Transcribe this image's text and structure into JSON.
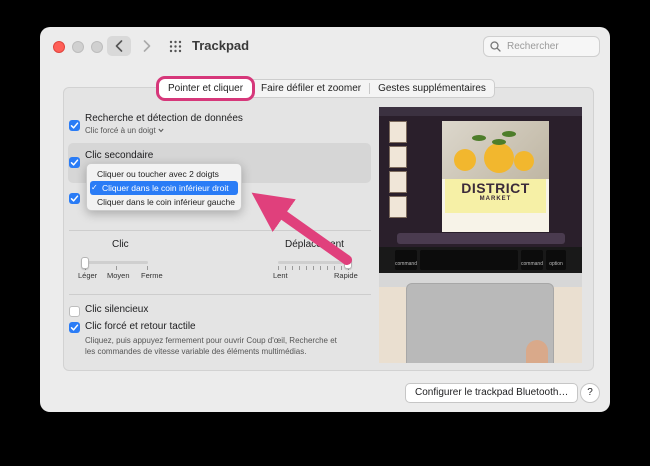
{
  "window": {
    "title": "Trackpad",
    "search_placeholder": "Rechercher"
  },
  "tabs": [
    {
      "label": "Pointer et cliquer",
      "active": true
    },
    {
      "label": "Faire défiler et zoomer",
      "active": false
    },
    {
      "label": "Gestes supplémentaires",
      "active": false
    }
  ],
  "options": {
    "lookup": {
      "label": "Recherche et détection de données",
      "sub": "Clic forcé à un doigt",
      "checked": true
    },
    "secondary": {
      "label": "Clic secondaire",
      "checked": true
    },
    "third": {
      "checked": true
    },
    "silent": {
      "label": "Clic silencieux",
      "checked": false
    },
    "force": {
      "label": "Clic forcé et retour tactile",
      "desc1": "Cliquez, puis appuyez fermement pour ouvrir Coup d'œil, Recherche et",
      "desc2": "les commandes de vitesse variable des éléments multimédias.",
      "checked": true
    }
  },
  "dropdown": {
    "items": [
      {
        "label": "Cliquer ou toucher avec 2 doigts",
        "selected": false
      },
      {
        "label": "Cliquer dans le coin inférieur droit",
        "selected": true
      },
      {
        "label": "Cliquer dans le coin inférieur gauche",
        "selected": false
      }
    ]
  },
  "sliders": {
    "click": {
      "title": "Clic",
      "labels": [
        "Léger",
        "Moyen",
        "Ferme"
      ],
      "value_index": 0
    },
    "tracking": {
      "title": "Déplacement",
      "labels": [
        "Lent",
        "Rapide"
      ],
      "value_fraction": 1.0
    }
  },
  "preview": {
    "poster_title": "DISTRICT",
    "poster_sub": "MARKET",
    "key_left": "command",
    "key_right": "command",
    "key_option": "option"
  },
  "buttons": {
    "bluetooth": "Configurer le trackpad Bluetooth…",
    "help": "?"
  },
  "colors": {
    "accent": "#2a7cf6",
    "highlight_ring": "#d6377a",
    "arrow": "#e0407c"
  }
}
